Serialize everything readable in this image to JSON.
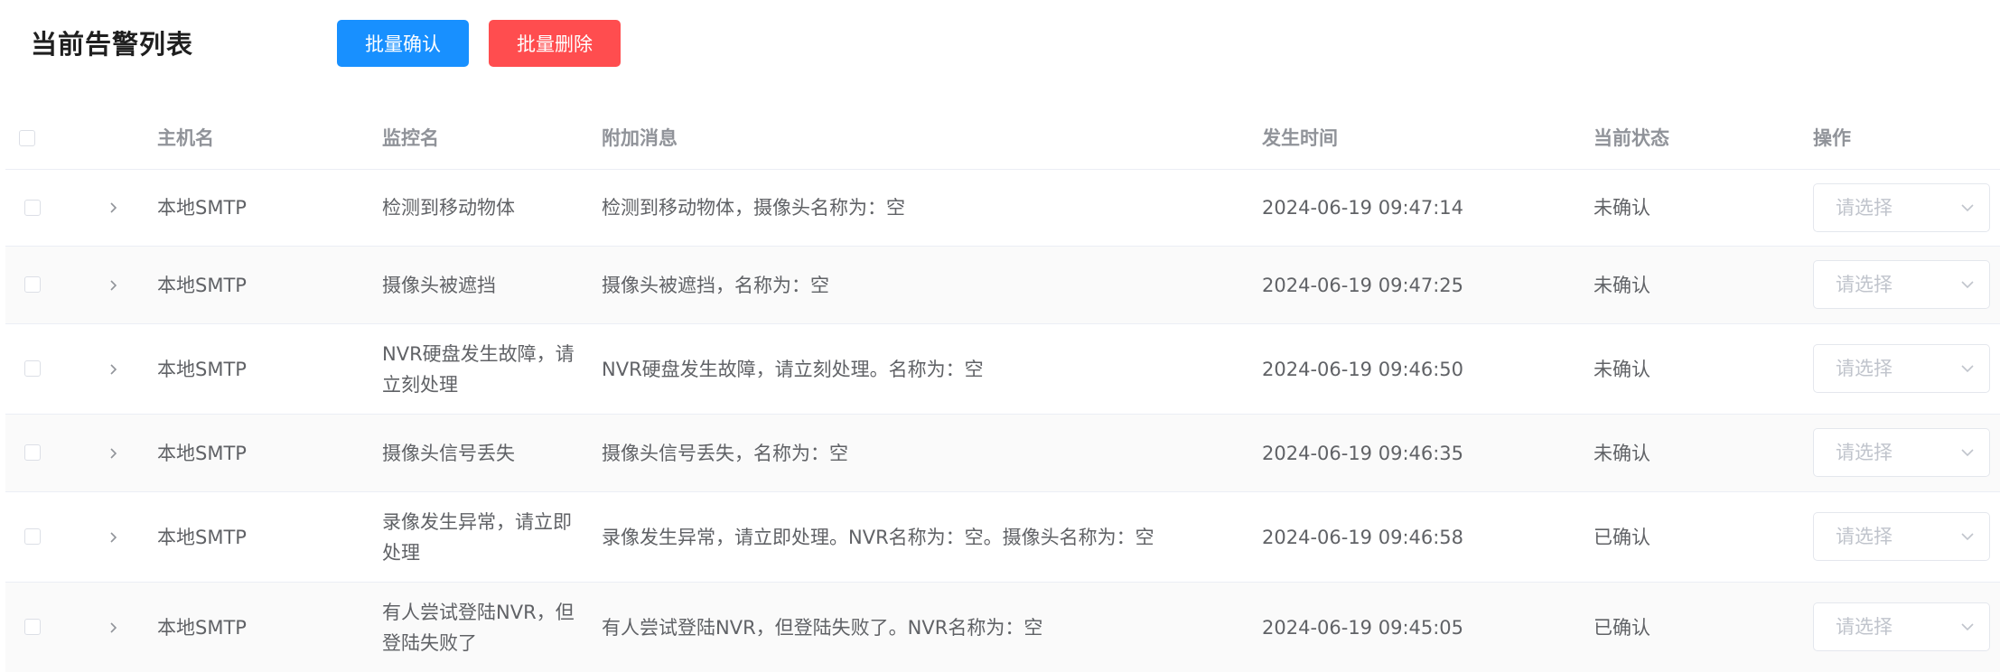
{
  "header": {
    "title": "当前告警列表",
    "batch_confirm_label": "批量确认",
    "batch_delete_label": "批量删除"
  },
  "table": {
    "columns": {
      "host": "主机名",
      "monitor": "监控名",
      "message": "附加消息",
      "time": "发生时间",
      "status": "当前状态",
      "action": "操作"
    },
    "select_placeholder": "请选择",
    "rows": [
      {
        "host": "本地SMTP",
        "monitor": "检测到移动物体",
        "message": "检测到移动物体，摄像头名称为：空",
        "time": "2024-06-19 09:47:14",
        "status": "未确认"
      },
      {
        "host": "本地SMTP",
        "monitor": "摄像头被遮挡",
        "message": "摄像头被遮挡，名称为：空",
        "time": "2024-06-19 09:47:25",
        "status": "未确认"
      },
      {
        "host": "本地SMTP",
        "monitor": "NVR硬盘发生故障，请立刻处理",
        "message": "NVR硬盘发生故障，请立刻处理。名称为：空",
        "time": "2024-06-19 09:46:50",
        "status": "未确认"
      },
      {
        "host": "本地SMTP",
        "monitor": "摄像头信号丢失",
        "message": "摄像头信号丢失，名称为：空",
        "time": "2024-06-19 09:46:35",
        "status": "未确认"
      },
      {
        "host": "本地SMTP",
        "monitor": "录像发生异常，请立即处理",
        "message": "录像发生异常，请立即处理。NVR名称为：空。摄像头名称为：空",
        "time": "2024-06-19 09:46:58",
        "status": "已确认"
      },
      {
        "host": "本地SMTP",
        "monitor": "有人尝试登陆NVR，但登陆失败了",
        "message": "有人尝试登陆NVR，但登陆失败了。NVR名称为：空",
        "time": "2024-06-19 09:45:05",
        "status": "已确认"
      }
    ]
  }
}
